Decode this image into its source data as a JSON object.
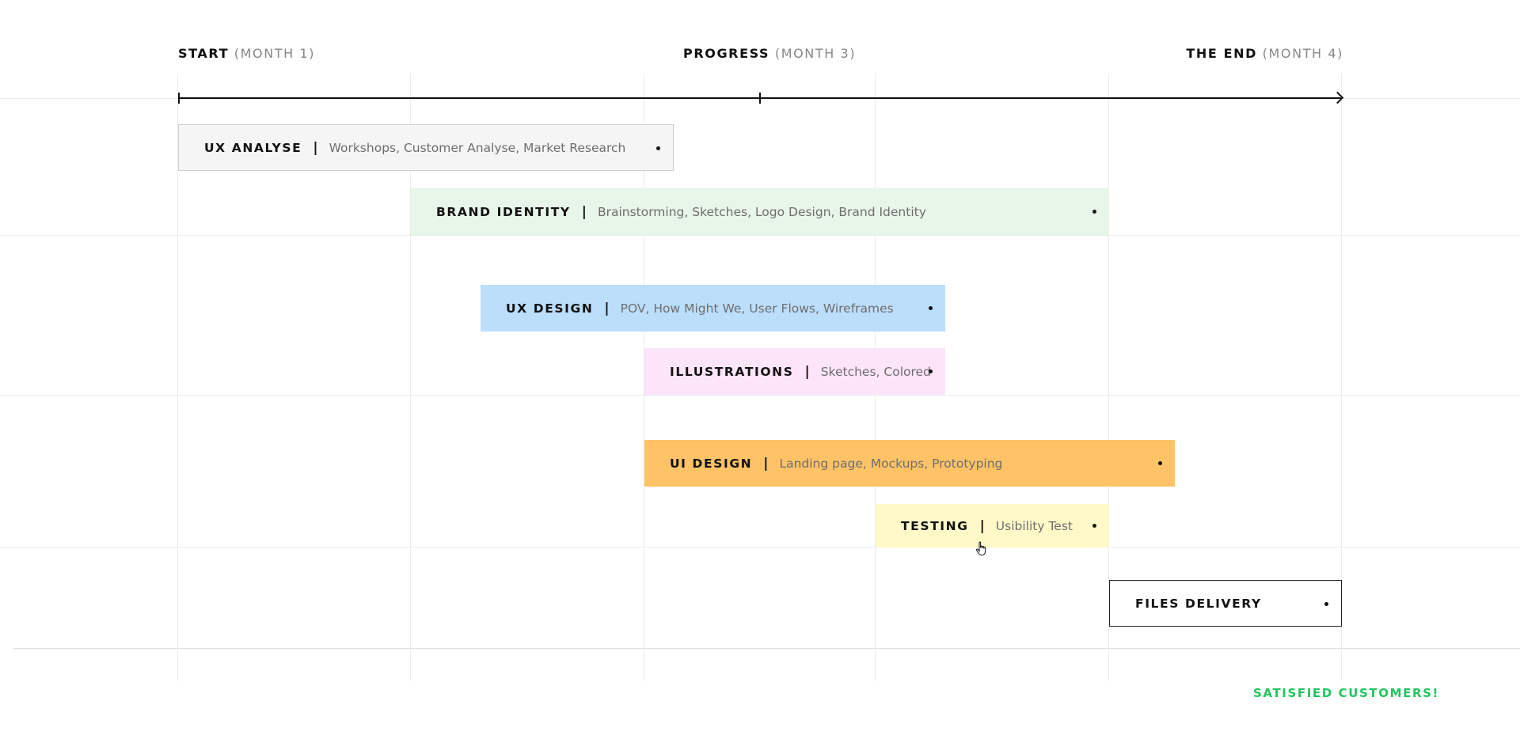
{
  "phases": [
    {
      "title": "START",
      "sub": "(MONTH 1)"
    },
    {
      "title": "PROGRESS",
      "sub": "(MONTH 3)"
    },
    {
      "title": "THE END",
      "sub": "(MONTH 4)"
    }
  ],
  "tasks": [
    {
      "title": "UX ANALYSE",
      "desc": "Workshops, Customer Analyse, Market Research",
      "color": "#f5f5f5"
    },
    {
      "title": "BRAND IDENTITY",
      "desc": "Brainstorming, Sketches, Logo Design, Brand Identity",
      "color": "#e8f5e9"
    },
    {
      "title": "UX DESIGN",
      "desc": "POV, How Might We, User Flows, Wireframes",
      "color": "#bbdefb"
    },
    {
      "title": "ILLUSTRATIONS",
      "desc": "Sketches, Colored",
      "color": "#fce4f9"
    },
    {
      "title": "UI DESIGN",
      "desc": "Landing page, Mockups, Prototyping",
      "color": "#ffc266"
    },
    {
      "title": "TESTING",
      "desc": "Usibility Test",
      "color": "#fff9c8"
    },
    {
      "title": "FILES DELIVERY",
      "desc": "",
      "color": "#ffffff"
    }
  ],
  "separator": "|",
  "footer": {
    "text": "SATISFIED CUSTOMERS!",
    "color": "#22c55e"
  },
  "cursor_icon": "hand-pointer-icon"
}
